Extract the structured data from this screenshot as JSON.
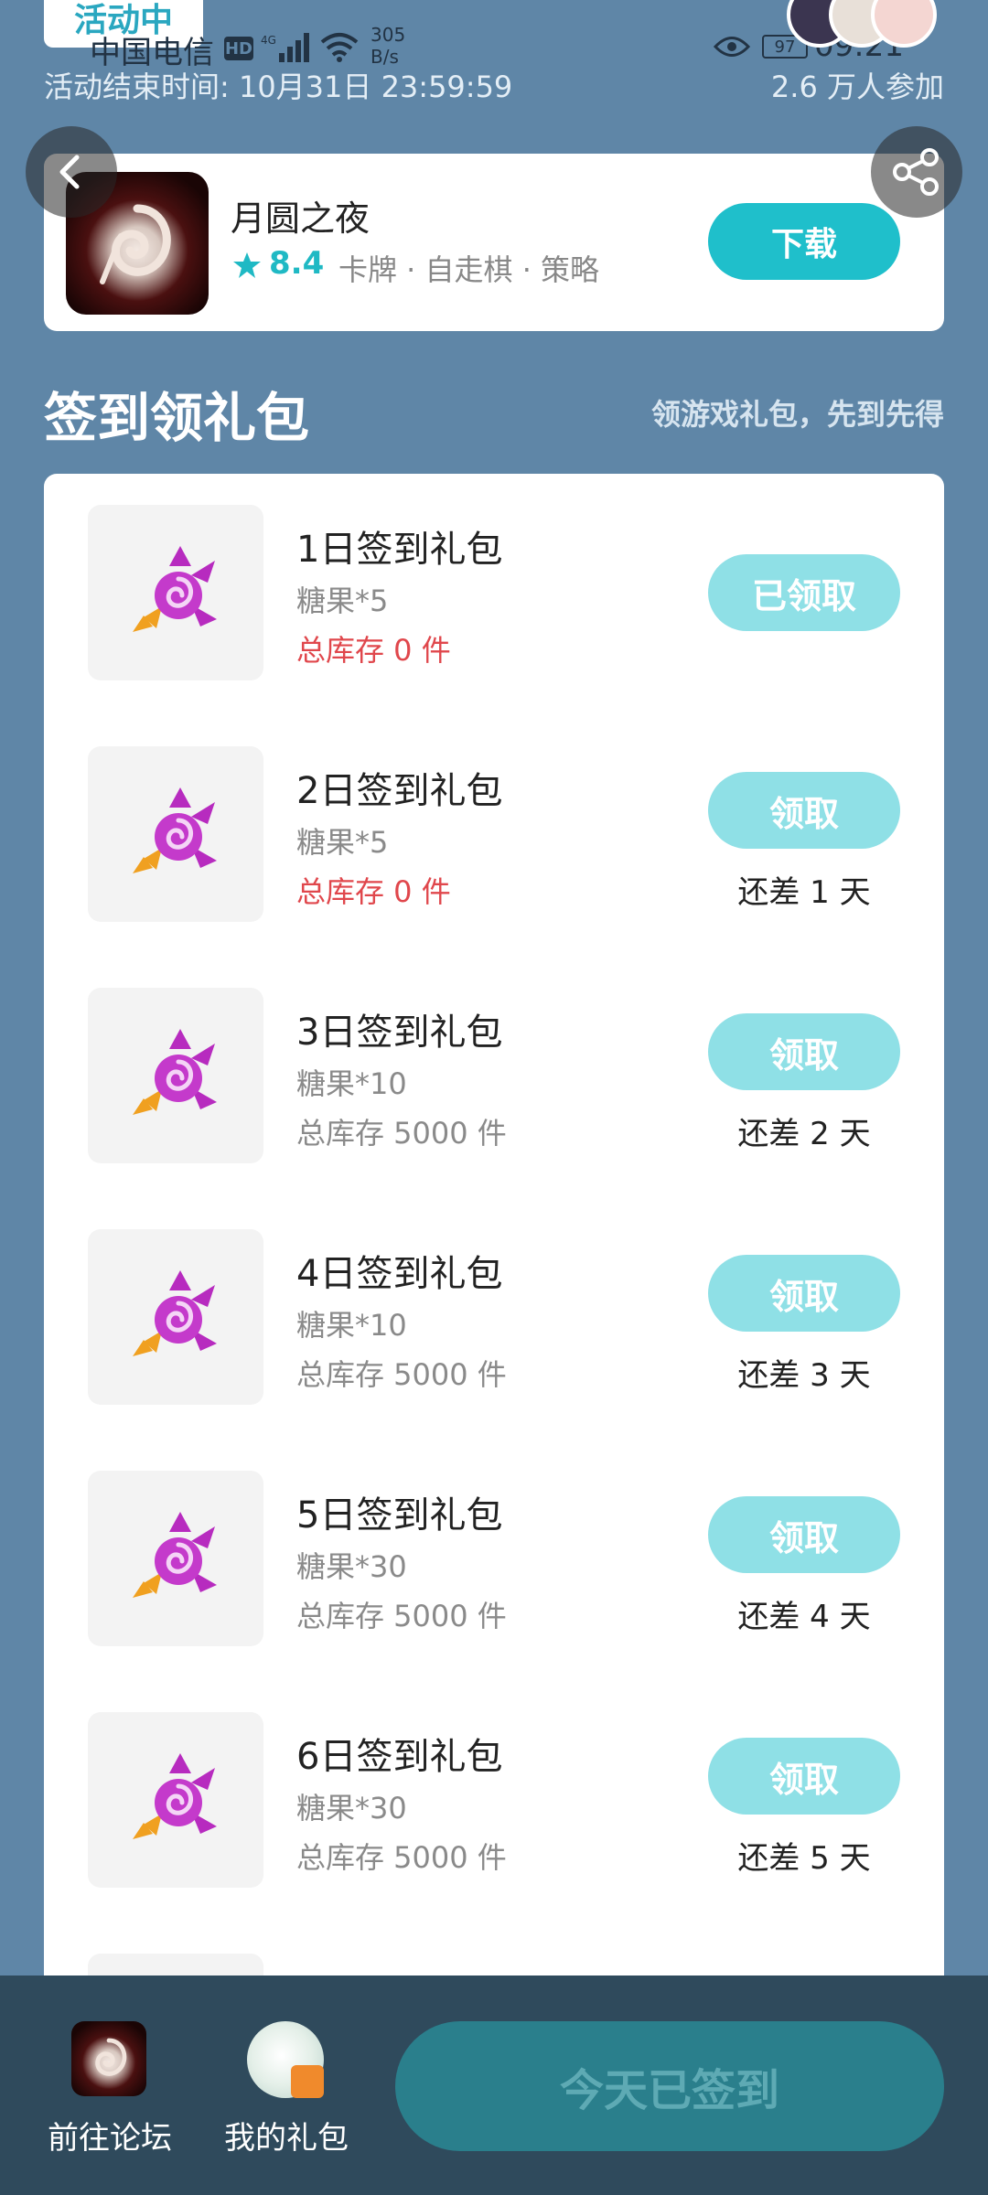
{
  "status_bar": {
    "activity_badge": "活动中",
    "carrier": "中国电信",
    "hd": "HD",
    "speed_value": "305",
    "speed_unit": "B/s",
    "battery": "97",
    "time": "09:21"
  },
  "header": {
    "end_time": "活动结束时间: 10月31日 23:59:59",
    "participants": "2.6 万人参加"
  },
  "game": {
    "name": "月圆之夜",
    "rating": "8.4",
    "tags": "卡牌 · 自走棋 · 策略",
    "download_label": "下载"
  },
  "section": {
    "title": "签到领礼包",
    "subtitle": "领游戏礼包，先到先得"
  },
  "gifts": [
    {
      "title": "1日签到礼包",
      "item": "糖果*5",
      "stock": "总库存 0 件",
      "button": "已领取",
      "days_left": ""
    },
    {
      "title": "2日签到礼包",
      "item": "糖果*5",
      "stock": "总库存 0 件",
      "button": "领取",
      "days_left": "还差 1 天"
    },
    {
      "title": "3日签到礼包",
      "item": "糖果*10",
      "stock": "总库存 5000 件",
      "button": "领取",
      "days_left": "还差 2 天"
    },
    {
      "title": "4日签到礼包",
      "item": "糖果*10",
      "stock": "总库存 5000 件",
      "button": "领取",
      "days_left": "还差 3 天"
    },
    {
      "title": "5日签到礼包",
      "item": "糖果*30",
      "stock": "总库存 5000 件",
      "button": "领取",
      "days_left": "还差 4 天"
    },
    {
      "title": "6日签到礼包",
      "item": "糖果*30",
      "stock": "总库存 5000 件",
      "button": "领取",
      "days_left": "还差 5 天"
    }
  ],
  "bottom_bar": {
    "forum_label": "前往论坛",
    "my_gifts_label": "我的礼包",
    "signed_label": "今天已签到"
  },
  "colors": {
    "background": "#5f86a7",
    "accent": "#1fbfcb",
    "stock_empty": "#e0474c",
    "bottom_bar": "#2f4a5c"
  }
}
